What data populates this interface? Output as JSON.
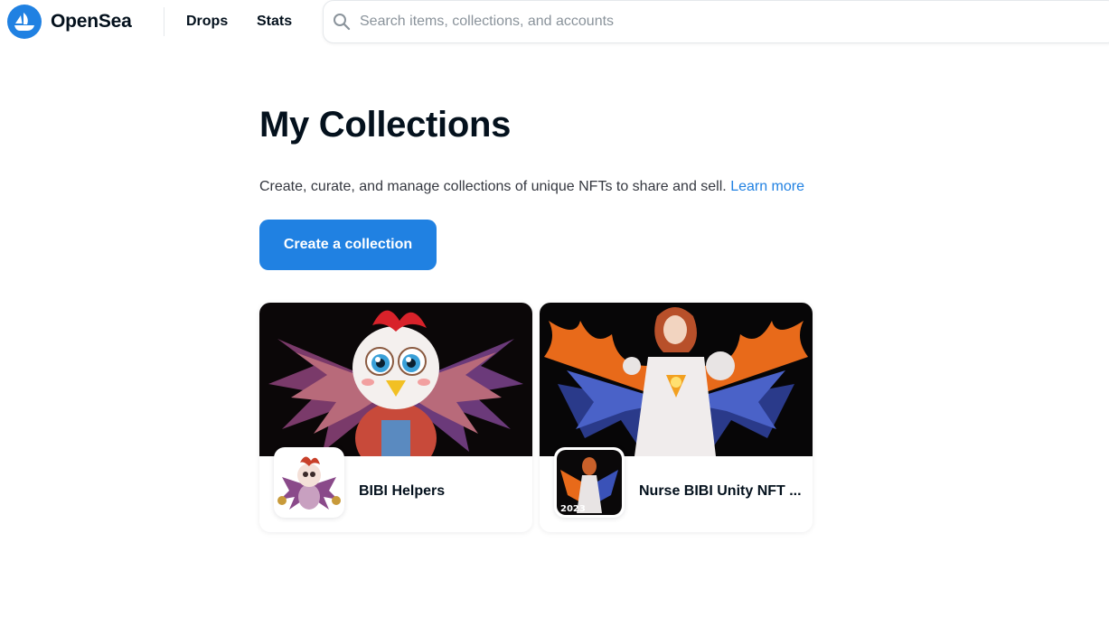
{
  "header": {
    "brand": "OpenSea",
    "nav": [
      {
        "label": "Drops"
      },
      {
        "label": "Stats"
      }
    ],
    "search": {
      "placeholder": "Search items, collections, and accounts",
      "value": ""
    }
  },
  "main": {
    "title": "My Collections",
    "description": "Create, curate, and manage collections of unique NFTs to share and sell.",
    "learn_more": "Learn more",
    "create_button": "Create a collection",
    "collections": [
      {
        "name": "BIBI Helpers",
        "image": "chicken-mascot-illustration"
      },
      {
        "name": "Nurse BIBI Unity NFT ...",
        "image": "flame-winged-nurse-illustration",
        "thumb_caption": "2023"
      }
    ]
  },
  "colors": {
    "brand_blue": "#2081e2",
    "text_primary": "#04111d",
    "text_secondary": "#353840",
    "placeholder": "#8a939b"
  }
}
